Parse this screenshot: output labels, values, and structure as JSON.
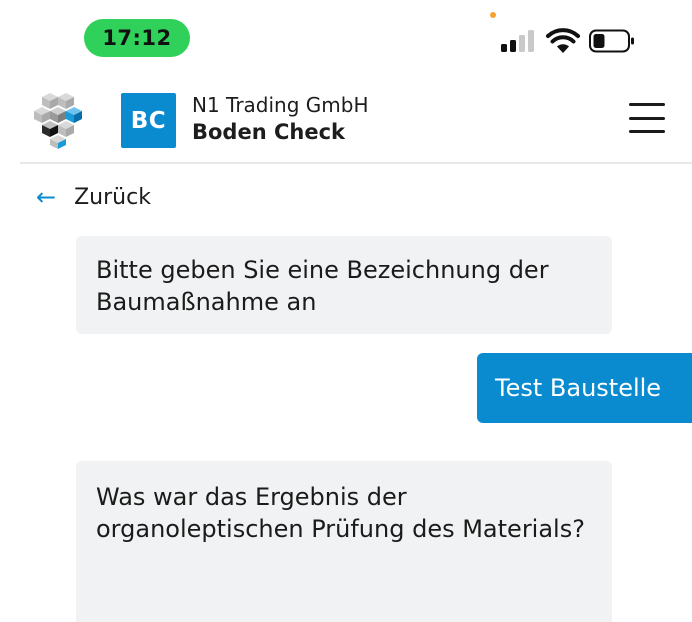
{
  "status_bar": {
    "time": "17:12",
    "icons": [
      "signal-icon",
      "wifi-icon",
      "battery-icon"
    ]
  },
  "header": {
    "logo_icon": "cubes-logo-icon",
    "badge": "BC",
    "company": "N1 Trading GmbH",
    "product": "Boden Check",
    "menu_icon": "hamburger-menu-icon"
  },
  "nav": {
    "back_label": "Zurück",
    "back_icon": "arrow-left-icon"
  },
  "messages": [
    {
      "from": "bot",
      "text": "Bitte geben Sie eine Bezeichnung der Baumaßnahme an"
    },
    {
      "from": "user",
      "text": "Test Baustelle"
    },
    {
      "from": "bot",
      "text": "Was war das Ergebnis der organoleptischen Prüfung des Materials?"
    }
  ],
  "colors": {
    "accent": "#0a8bd0",
    "time_pill": "#2fd15a",
    "bot_bubble": "#f1f2f3",
    "privacy_dot": "#f4a234"
  }
}
